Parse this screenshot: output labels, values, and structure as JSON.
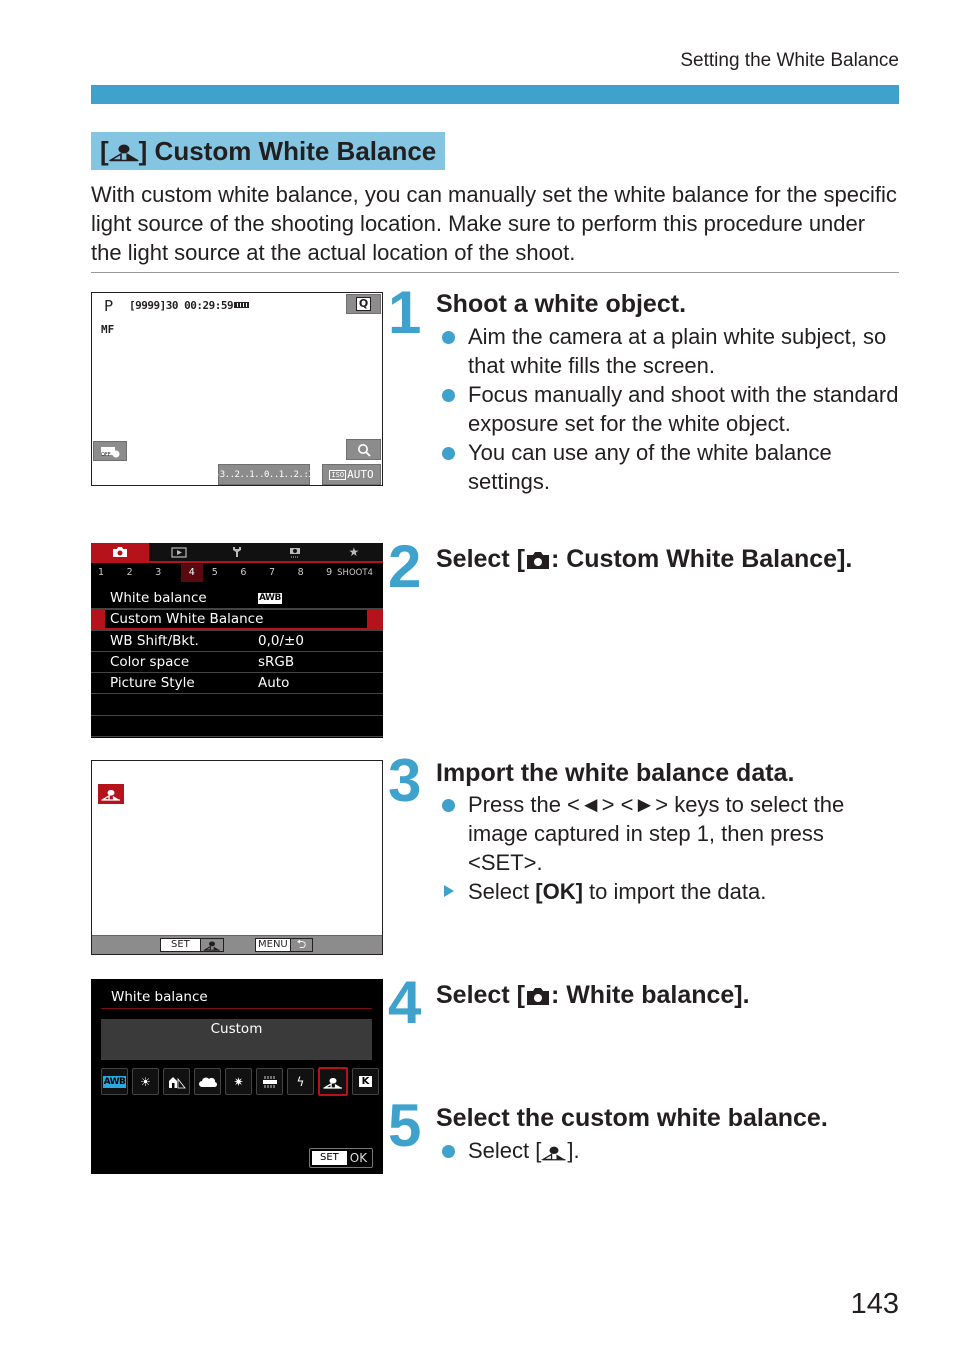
{
  "running_head": "Setting the White Balance",
  "section": {
    "title_prefix": "[",
    "title_suffix": "] Custom White Balance",
    "icon": "custom-wb-icon"
  },
  "intro": "With custom white balance, you can manually set the white balance for the specific light source of the shooting location. Make sure to perform this procedure under the light source at the actual location of the shoot.",
  "steps": [
    {
      "number": "1",
      "title": "Shoot a white object.",
      "bullets": [
        {
          "type": "dot",
          "text": "Aim the camera at a plain white subject, so that white fills the screen."
        },
        {
          "type": "dot",
          "text": "Focus manually and shoot with the standard exposure set for the white object."
        },
        {
          "type": "dot",
          "text": "You can use any of the white balance settings."
        }
      ]
    },
    {
      "number": "2",
      "title_prefix": "Select [",
      "title_suffix": ": Custom White Balance]."
    },
    {
      "number": "3",
      "title": "Import the white balance data.",
      "bullets": [
        {
          "type": "dot",
          "text": "Press the <◄> <►> keys to select the image captured in step 1, then press <SET>."
        },
        {
          "type": "triangle",
          "text_prefix": "Select ",
          "text_bold": "[OK]",
          "text_suffix": " to import the data."
        }
      ]
    },
    {
      "number": "4",
      "title_prefix": "Select [",
      "title_suffix": ": White balance]."
    },
    {
      "number": "5",
      "title": "Select the custom white balance.",
      "bullets": [
        {
          "type": "dot",
          "text_prefix": "Select [",
          "text_suffix": "]."
        }
      ]
    }
  ],
  "screen1": {
    "mode": "P",
    "info": "[9999]30 00:29:59",
    "focus": "MF",
    "q_button": "Q",
    "exposure_scale": "-3..2..1..0..1..2.:3",
    "iso_label": "ISO",
    "iso_value": "AUTO"
  },
  "screen2": {
    "tabs": [
      "camera",
      "playback",
      "wrench",
      "custom",
      "star"
    ],
    "subtabs": [
      "1",
      "2",
      "3",
      "4",
      "5",
      "6",
      "7",
      "8",
      "9"
    ],
    "active_subtab": "4",
    "subtab_label": "SHOOT4",
    "rows": [
      {
        "label": "White balance",
        "value": "AWB",
        "badge": true
      },
      {
        "label": "Custom White Balance",
        "value": "",
        "selected": true
      },
      {
        "label": "WB Shift/Bkt.",
        "value": "0,0/±0"
      },
      {
        "label": "Color space",
        "value": "sRGB"
      },
      {
        "label": "Picture Style",
        "value": "Auto"
      },
      {
        "label": "",
        "value": ""
      },
      {
        "label": "",
        "value": ""
      }
    ]
  },
  "screen3": {
    "set_label": "SET",
    "menu_label": "MENU",
    "back_glyph": "⮌"
  },
  "screen4": {
    "header": "White balance",
    "current_value": "Custom",
    "options": [
      "AWB",
      "Daylight",
      "Shade",
      "Cloudy",
      "Tungsten",
      "Fluorescent",
      "Flash",
      "Custom",
      "K"
    ],
    "selected_option": "Custom",
    "set_label": "SET",
    "ok_label": "OK"
  },
  "page_number": "143",
  "colors": {
    "accent_blue": "#3fa2cc",
    "title_bg": "#84c5e1",
    "canon_red": "#b5121b"
  }
}
